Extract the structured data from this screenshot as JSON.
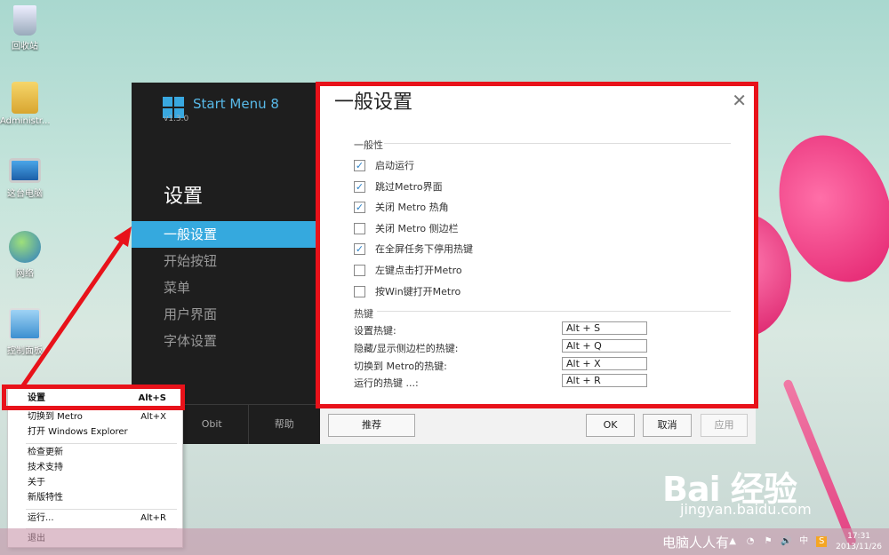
{
  "desktop_icons": [
    {
      "label": "回收站"
    },
    {
      "label": "Administr..."
    },
    {
      "label": "这台电脑"
    },
    {
      "label": "网络"
    },
    {
      "label": "控制面板"
    }
  ],
  "app": {
    "name": "Start Menu 8",
    "version": "v1.3.0",
    "pane_title": "设置",
    "nav": [
      "一般设置",
      "开始按钮",
      "菜单",
      "用户界面",
      "字体设置"
    ],
    "bottom": {
      "left": "Obit",
      "right": "帮助"
    }
  },
  "dialog": {
    "title": "一般设置",
    "general_label": "一般性",
    "checkboxes": [
      {
        "label": "启动运行",
        "checked": true,
        "mark": "✓"
      },
      {
        "label": "跳过Metro界面",
        "checked": true,
        "mark": "✓"
      },
      {
        "label": "关闭 Metro 热角",
        "checked": true,
        "mark": "✓"
      },
      {
        "label": "关闭 Metro 侧边栏",
        "checked": false,
        "mark": ""
      },
      {
        "label": "在全屏任务下停用热键",
        "checked": true,
        "mark": "✓"
      },
      {
        "label": "左键点击打开Metro",
        "checked": false,
        "mark": ""
      },
      {
        "label": "按Win键打开Metro",
        "checked": false,
        "mark": ""
      }
    ],
    "hotkey_label": "热键",
    "hotkeys": [
      {
        "label": "设置热键:",
        "value": "Alt + S"
      },
      {
        "label": "隐藏/显示侧边栏的热键:",
        "value": "Alt + Q"
      },
      {
        "label": "切换到 Metro的热键:",
        "value": "Alt + X"
      },
      {
        "label": "运行的热键 ...:",
        "value": "Alt + R"
      }
    ],
    "buttons": {
      "recommend": "推荐",
      "ok": "OK",
      "cancel": "取消",
      "apply": "应用"
    }
  },
  "context_menu": {
    "items": [
      {
        "label": "设置",
        "shortcut": "Alt+S"
      },
      {
        "label": "切换到 Metro",
        "shortcut": "Alt+X"
      },
      {
        "label": "打开 Windows Explorer",
        "shortcut": ""
      },
      {
        "label": "检查更新",
        "shortcut": ""
      },
      {
        "label": "技术支持",
        "shortcut": ""
      },
      {
        "label": "关于",
        "shortcut": ""
      },
      {
        "label": "新版特性",
        "shortcut": ""
      },
      {
        "label": "运行...",
        "shortcut": "Alt+R"
      },
      {
        "label": "退出",
        "shortcut": ""
      }
    ]
  },
  "taskbar": {
    "ime": "中",
    "time": "17:31",
    "date": "2013/11/26"
  },
  "watermark": {
    "brand": "Bai 经验",
    "url": "jingyan.baidu.com",
    "caption": "电脑人人有"
  },
  "colors": {
    "accent": "#35a9de",
    "highlight_border": "#e8121a"
  }
}
